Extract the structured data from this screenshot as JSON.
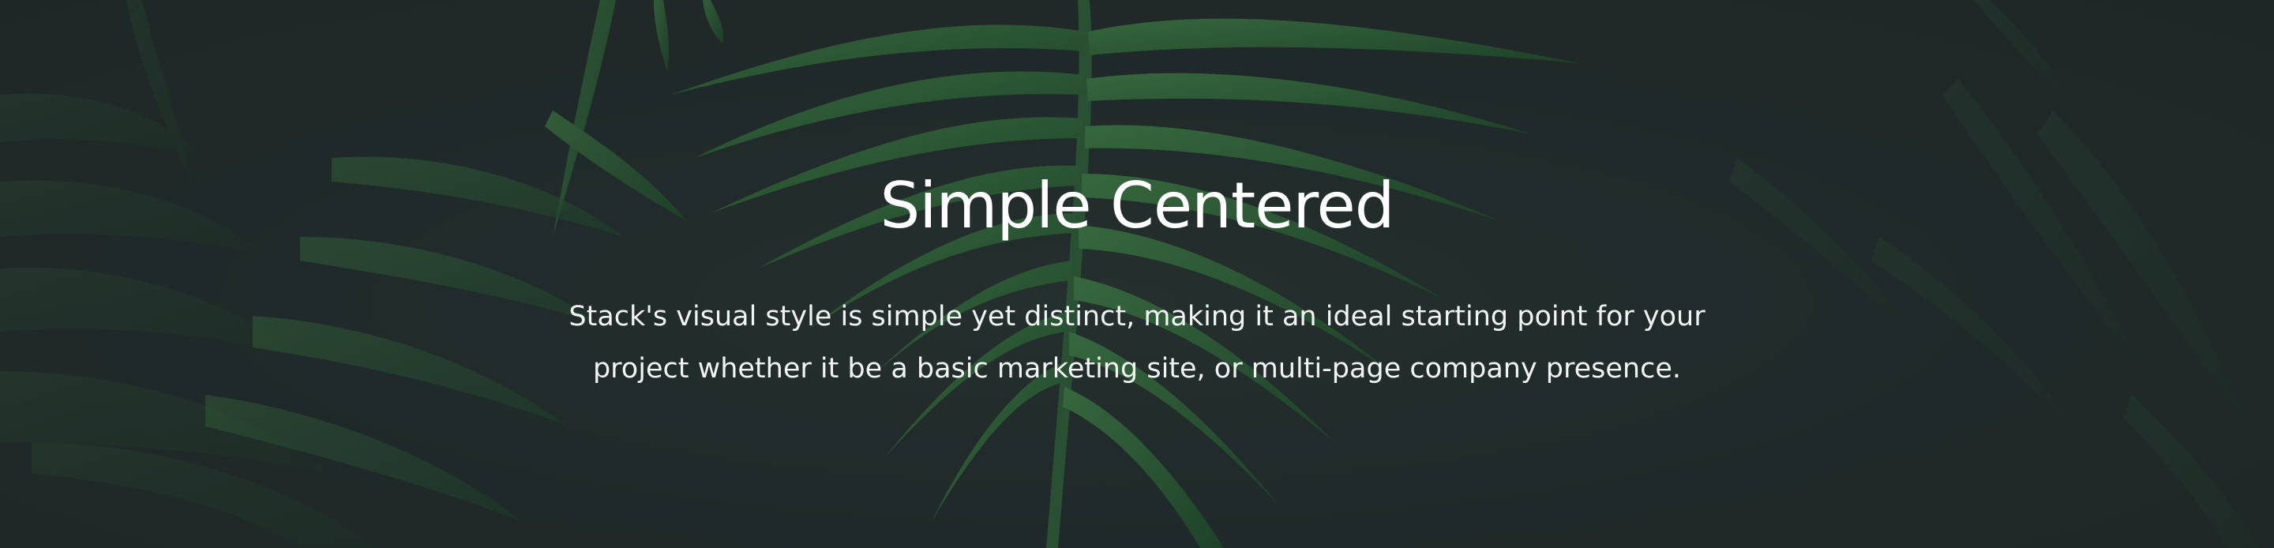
{
  "hero": {
    "background_image": "dark-fern-foliage",
    "title": "Simple Centered",
    "lead": "Stack's visual style is simple yet distinct, making it an ideal starting point for your project whether it be a basic marketing site, or multi-page company presence."
  },
  "colors": {
    "background": "#232b2b",
    "leaf_dark": "#1f3b2a",
    "leaf_mid": "#2d5a38",
    "leaf_light": "#3c7343",
    "text": "#ffffff"
  }
}
